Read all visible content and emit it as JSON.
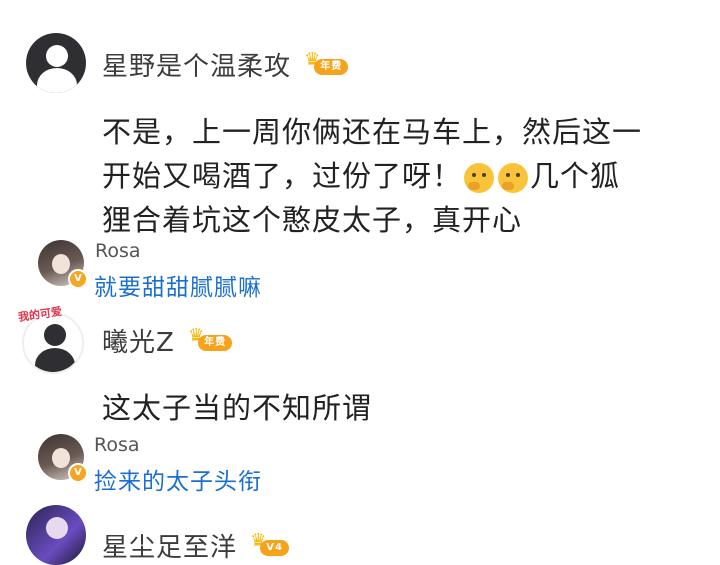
{
  "comments": [
    {
      "username": "星野是个温柔攻",
      "vip_tag": "年费",
      "text_lines": [
        "不是，上一周你俩还在马车上，然后这一",
        "开始又喝酒了，过份了呀！",
        "几个狐",
        "狸合着坑这个憨皮太子，真开心"
      ],
      "emoji": [
        "thinking-face-icon",
        "thinking-face-icon"
      ],
      "reply": {
        "username": "Rosa",
        "text": "就要甜甜腻腻嘛"
      }
    },
    {
      "username": "曦光Z",
      "vip_tag": "年费",
      "avatar_sticker": "我的可爱",
      "text": "这太子当的不知所谓",
      "reply": {
        "username": "Rosa",
        "text": "捡来的太子头衔"
      }
    },
    {
      "username": "星尘足至洋",
      "vip_tag": "V4"
    }
  ],
  "colors": {
    "link": "#1a6fd1",
    "vip": "#f7a21b",
    "text": "#222222"
  }
}
